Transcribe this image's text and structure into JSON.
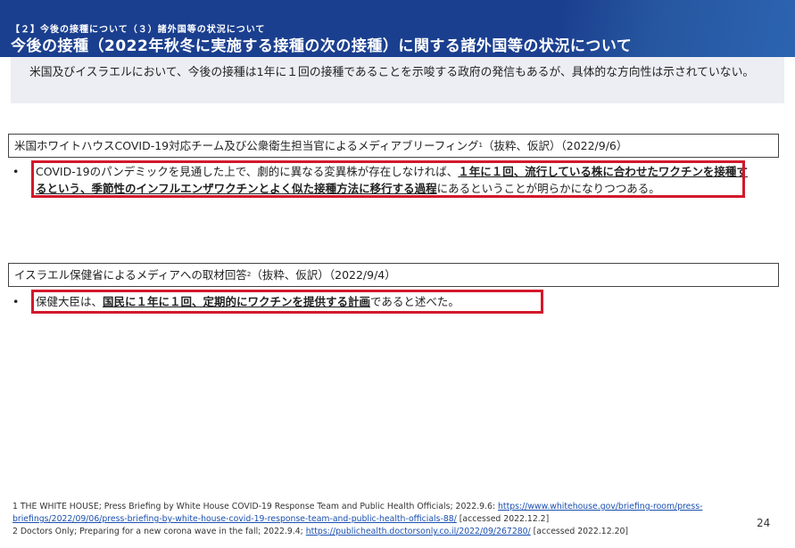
{
  "header": {
    "subtitle": "【２】今後の接種について（３）諸外国等の状況について",
    "title": "今後の接種（2022年秋冬に実施する接種の次の接種）に関する諸外国等の状況について",
    "background_color": "#1b3f8f"
  },
  "summary": {
    "text": "米国及びイスラエルにおいて、今後の接種は1年に１回の接種であることを示唆する政府の発信もあるが、具体的な方向性は示されていない。"
  },
  "sections": [
    {
      "header_main": "米国ホワイトハウスCOVID-19対応チーム及び公衆衛生担当官によるメディアブリーフィング",
      "header_ref": "1",
      "header_suffix": "（抜粋、仮訳）（2022/9/6）",
      "bullet": "•",
      "text_before": "COVID-19のパンデミックを見通した上で、劇的に異なる変異株が存在しなければ、",
      "text_bold": "１年に１回、流行している株に合わせたワクチンを接種するという、季節性のインフルエンザワクチンとよく似た接種方法に移行する過程",
      "text_after": "にあるということが明らかになりつつある。"
    },
    {
      "header_main": "イスラエル保健省によるメディアへの取材回答",
      "header_ref": "2",
      "header_suffix": "（抜粋、仮訳）（2022/9/4）",
      "bullet": "•",
      "text_before": "保健大臣は、",
      "text_bold": "国民に１年に１回、定期的にワクチンを提供する計画",
      "text_after": "であると述べた。"
    }
  ],
  "footnotes": [
    {
      "text": "1 THE WHITE HOUSE; Press Briefing by White House COVID-19 Response Team and Public Health Officials; 2022.9.6: ",
      "link": "https://www.whitehouse.gov/briefing-room/press-briefings/2022/09/06/press-briefing-by-white-house-covid-19-response-team-and-public-health-officials-88/",
      "accessed": " [accessed 2022.12.2]"
    },
    {
      "text": "2 Doctors Only; Preparing for a new corona wave in the fall; 2022.9.4; ",
      "link": "https://publichealth.doctorsonly.co.il/2022/09/267280/",
      "accessed": " [accessed 2022.12.20]"
    }
  ],
  "page_number": "24",
  "highlight_color": "#d3182b"
}
